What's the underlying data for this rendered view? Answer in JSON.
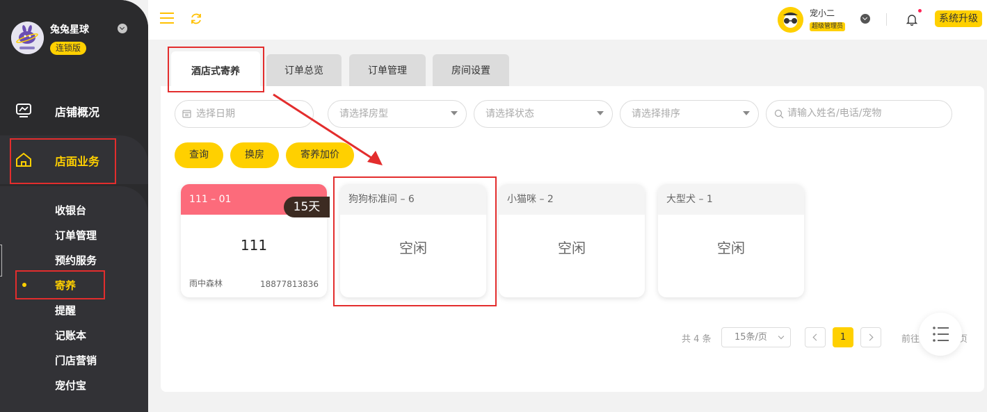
{
  "brand": {
    "name": "兔兔星球",
    "badge": "连锁版"
  },
  "nav": {
    "overview": "店铺概况",
    "store_business": "店面业务",
    "sub_items": [
      "收银台",
      "订单管理",
      "预约服务",
      "寄养",
      "提醒",
      "记账本",
      "门店营销",
      "宠付宝"
    ],
    "active_sub": "寄养"
  },
  "header": {
    "user_name": "宠小二",
    "user_role": "超级管理员",
    "upgrade": "系统升级"
  },
  "tabs": [
    {
      "label": "酒店式寄养",
      "active": true
    },
    {
      "label": "订单总览",
      "active": false
    },
    {
      "label": "订单管理",
      "active": false
    },
    {
      "label": "房间设置",
      "active": false
    }
  ],
  "filters": {
    "date_placeholder": "选择日期",
    "room_type_placeholder": "请选择房型",
    "status_placeholder": "请选择状态",
    "sort_placeholder": "请选择排序",
    "search_placeholder": "请输入姓名/电话/宠物"
  },
  "buttons": {
    "query": "查询",
    "change_room": "换房",
    "price_increase": "寄养加价"
  },
  "rooms": [
    {
      "title": "111 – 01",
      "status": "111",
      "days": "15天",
      "customer": "雨中森林",
      "phone": "18877813836"
    },
    {
      "title": "狗狗标准间 – 6",
      "status": "空闲"
    },
    {
      "title": "小猫咪 – 2",
      "status": "空闲"
    },
    {
      "title": "大型犬 – 1",
      "status": "空闲"
    }
  ],
  "pagination": {
    "total": "共 4 条",
    "page_size": "15条/页",
    "current": "1",
    "goto": "前往",
    "goto_end": "页"
  },
  "colors": {
    "accent": "#ffd000",
    "occupied": "#fc6b7b",
    "sidebar": "#2b2b2d",
    "annotation": "#e32d2d"
  }
}
